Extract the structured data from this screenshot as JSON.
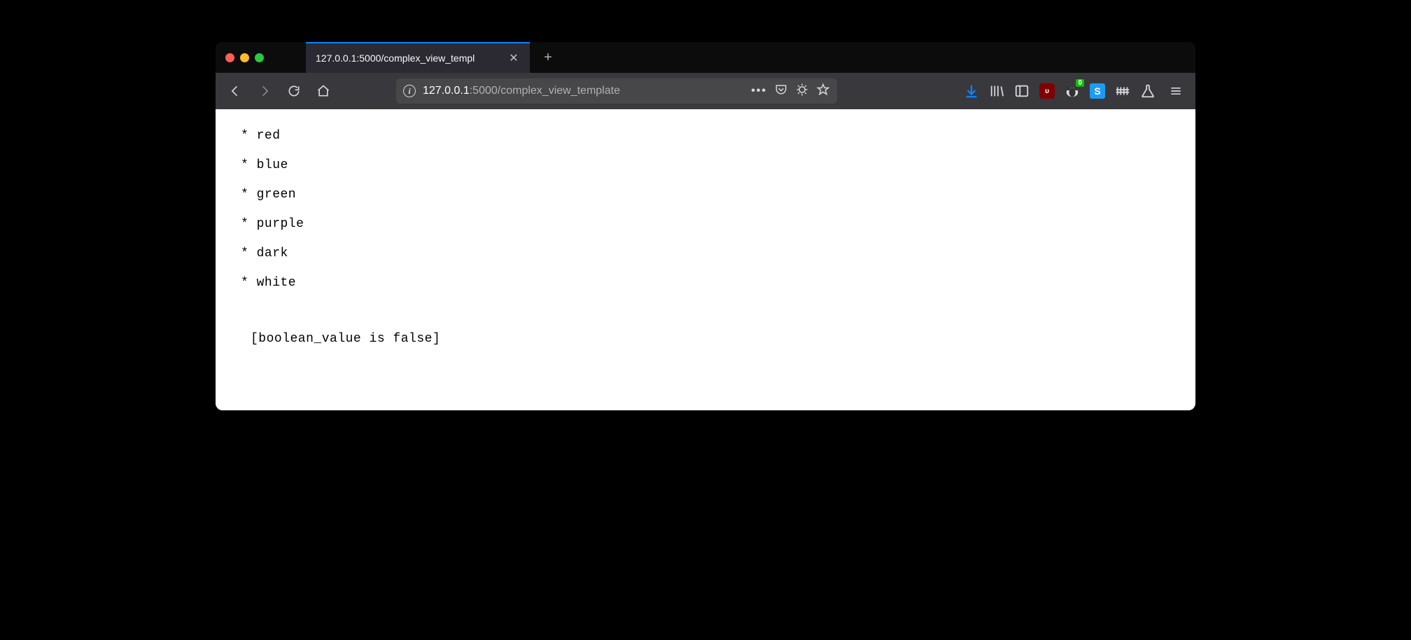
{
  "window": {
    "tab_title": "127.0.0.1:5000/complex_view_templ"
  },
  "urlbar": {
    "host": "127.0.0.1",
    "port": ":5000",
    "path": "/complex_view_template"
  },
  "extensions": {
    "badge_zero": "0",
    "s_label": "S"
  },
  "content": {
    "bullet": "*",
    "colors": [
      "red",
      "blue",
      "green",
      "purple",
      "dark",
      "white"
    ],
    "boolean_line": "[boolean_value is false]"
  }
}
